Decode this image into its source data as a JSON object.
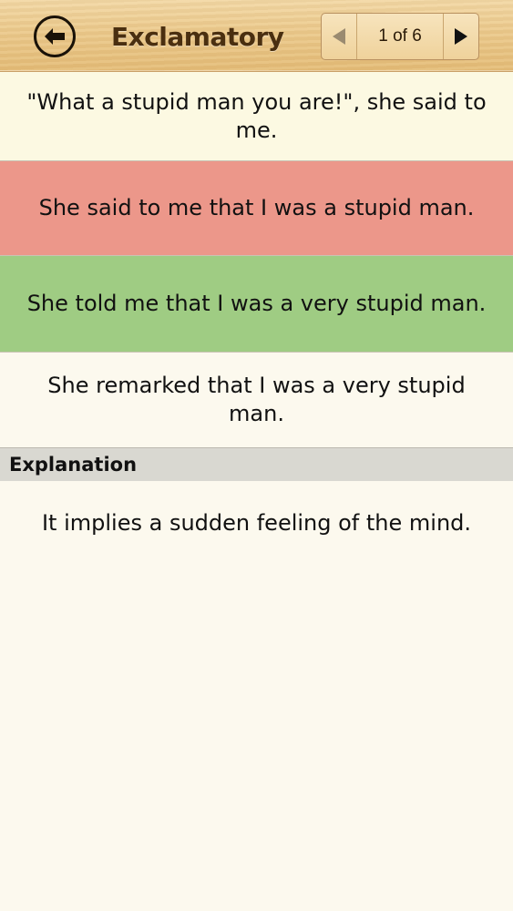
{
  "header": {
    "back_icon": "back-arrow-icon",
    "title": "Exclamatory",
    "pager": {
      "prev_icon": "triangle-left-icon",
      "count": "1 of 6",
      "next_icon": "triangle-right-icon"
    }
  },
  "question": {
    "text": "\"What a stupid man you are!\", she said to me."
  },
  "options": [
    {
      "text": "She said to me that I was a stupid man.",
      "state": "wrong",
      "color": "#ec978a"
    },
    {
      "text": "She told me that I was a very stupid man.",
      "state": "correct",
      "color": "#9fcc83"
    },
    {
      "text": "She remarked that I was a very stupid man.",
      "state": "neutral",
      "color": "#fcf9ee"
    }
  ],
  "explanation": {
    "heading": "Explanation",
    "text": "It implies a sudden feeling of the mind."
  }
}
